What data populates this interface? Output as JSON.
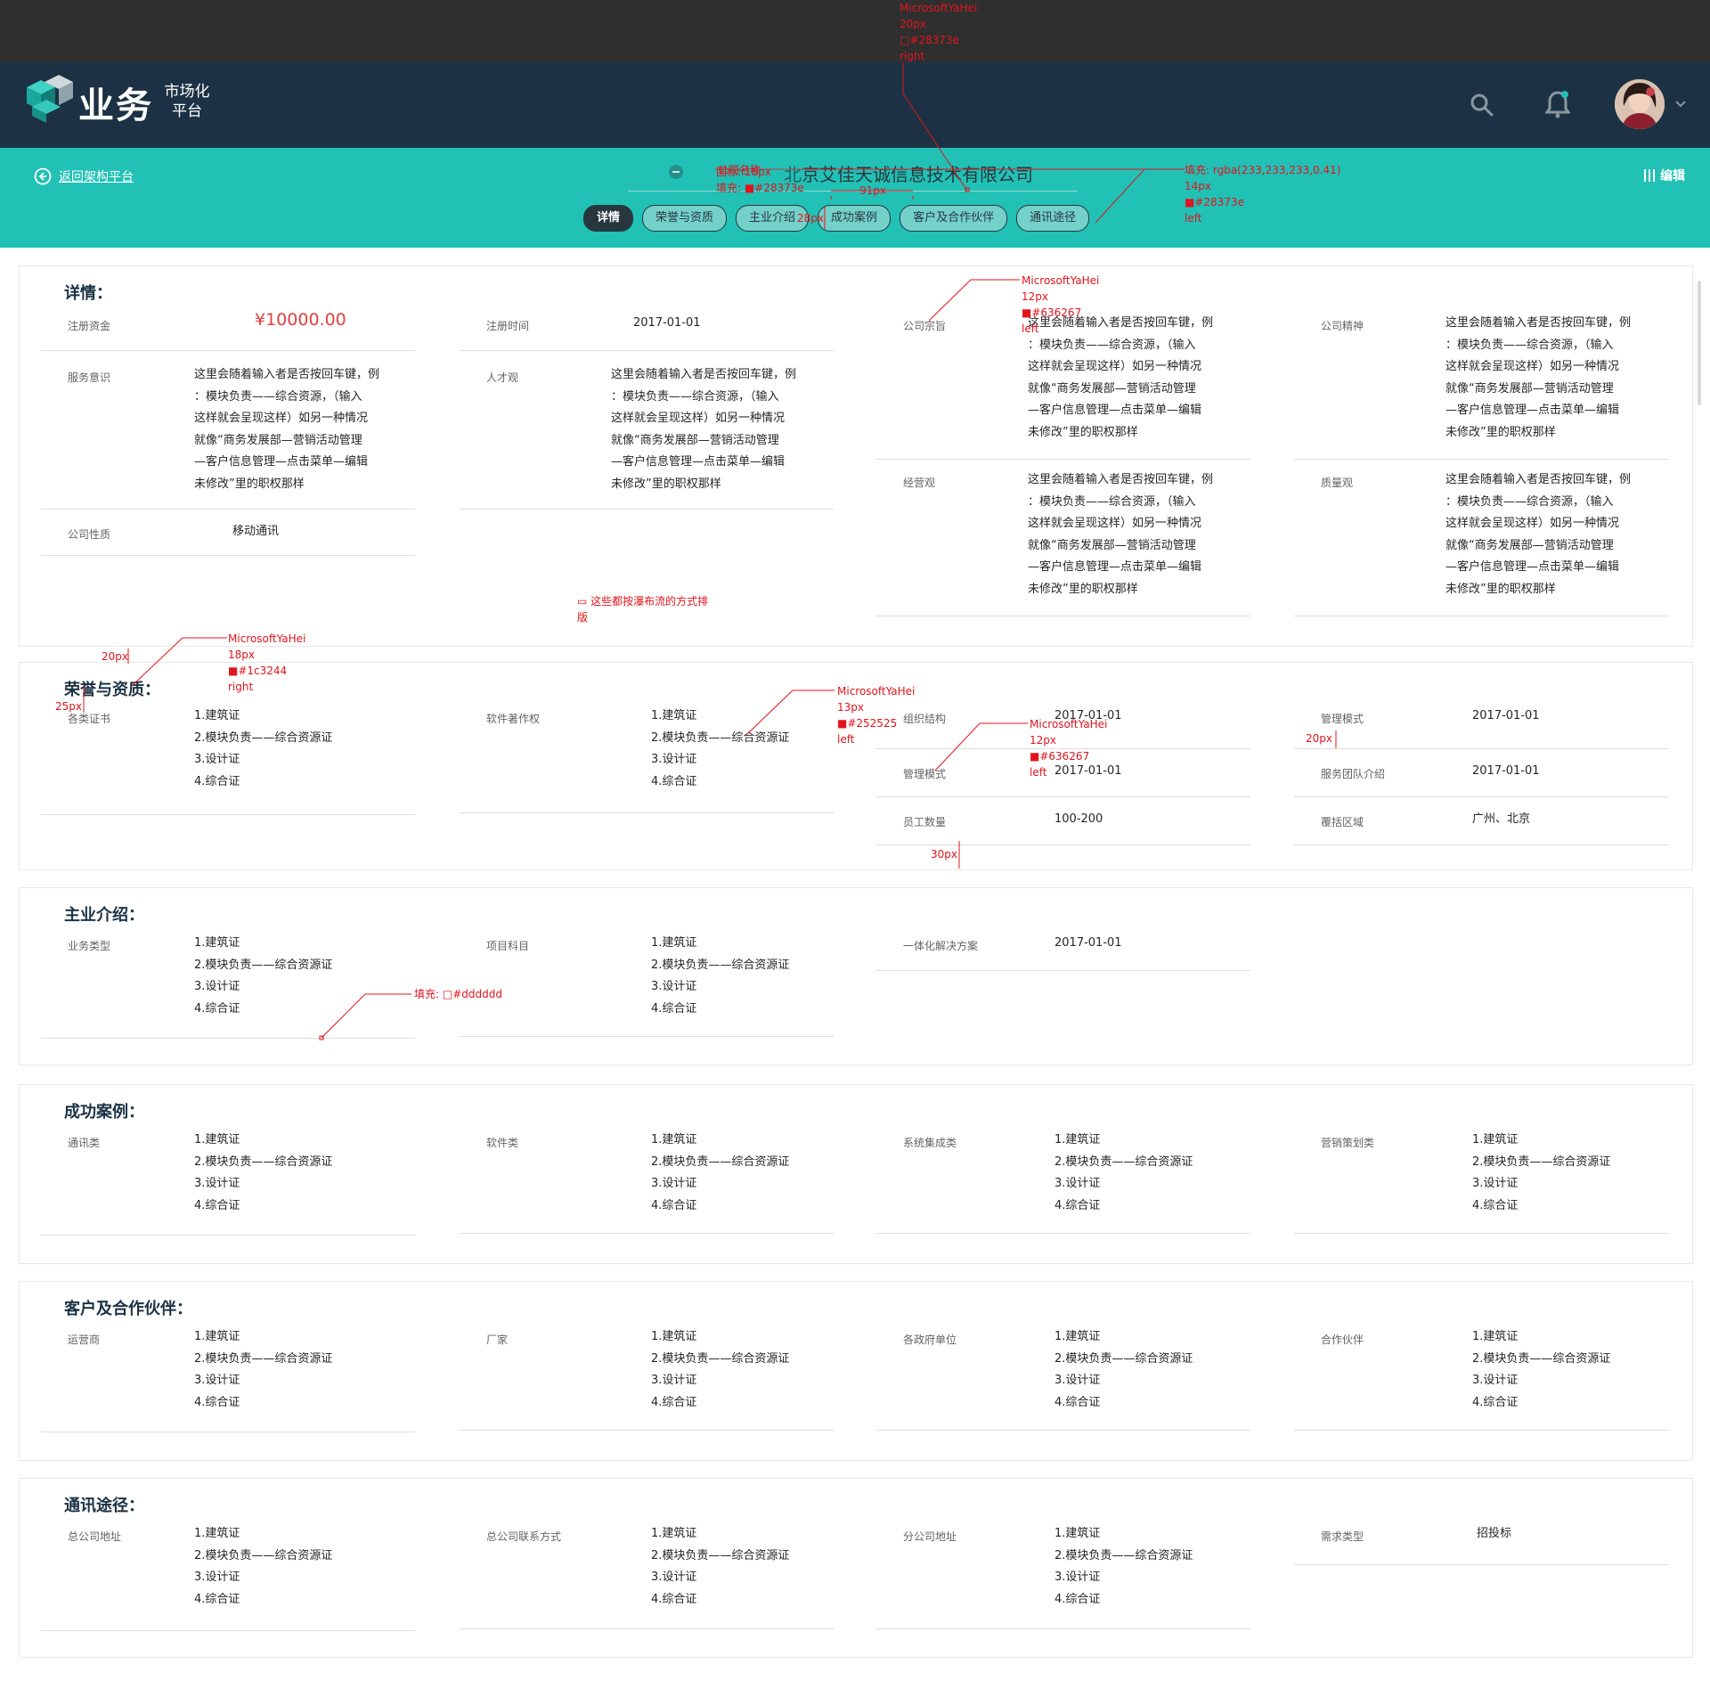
{
  "header": {
    "logo_main": "业务",
    "logo_sub": "市场化 平台",
    "avatar_alt": "avatar"
  },
  "subbar": {
    "back_label": "返回架构平台",
    "company_name": "北京艾佳天诚信息技术有限公司",
    "edit_label": "编辑",
    "tabs": [
      "详情",
      "荣誉与资质",
      "主业介绍",
      "成功案例",
      "客户及合作伙伴",
      "通讯途径"
    ]
  },
  "sections": {
    "detail": {
      "title": "详情：",
      "reg_capital_label": "注册资金",
      "reg_capital_value": "¥10000.00",
      "reg_time_label": "注册时间",
      "reg_time_value": "2017-01-01",
      "purpose_label": "公司宗旨",
      "purpose_value": "这里会随着输入者是否按回车键，例\n：模块负责——综合资源，（输入\n这样就会呈现这样）如另一种情况\n就像“商务发展部—营销活动管理\n—客户信息管理—点击菜单—编辑\n未修改”里的职权那样",
      "spirit_label": "公司精神",
      "spirit_value": "这里会随着输入者是否按回车键，例\n：模块负责——综合资源，（输入\n这样就会呈现这样）如另一种情况\n就像“商务发展部—营销活动管理\n—客户信息管理—点击菜单—编辑\n未修改”里的职权那样",
      "service_label": "服务意识",
      "service_value": "这里会随着输入者是否按回车键，例\n：模块负责——综合资源，（输入\n这样就会呈现这样）如另一种情况\n就像“商务发展部—营销活动管理\n—客户信息管理—点击菜单—编辑\n未修改”里的职权那样",
      "talent_label": "人才观",
      "talent_value": "这里会随着输入者是否按回车键，例\n：模块负责——综合资源，（输入\n这样就会呈现这样）如另一种情况\n就像“商务发展部—营销活动管理\n—客户信息管理—点击菜单—编辑\n未修改”里的职权那样",
      "business_label": "经营观",
      "business_value": "这里会随着输入者是否按回车键，例\n：模块负责——综合资源，（输入\n这样就会呈现这样）如另一种情况\n就像“商务发展部—营销活动管理\n—客户信息管理—点击菜单—编辑\n未修改”里的职权那样",
      "quality_label": "质量观",
      "quality_value": "这里会随着输入者是否按回车键，例\n：模块负责——综合资源，（输入\n这样就会呈现这样）如另一种情况\n就像“商务发展部—营销活动管理\n—客户信息管理—点击菜单—编辑\n未修改”里的职权那样",
      "nature_label": "公司性质",
      "nature_value": "移动通讯"
    },
    "honor": {
      "title": "荣誉与资质：",
      "cert_label": "各类证书",
      "cert_value": "1.建筑证\n2.模块负责——综合资源证\n3.设计证\n4.综合证",
      "software_label": "软件著作权",
      "software_value": "1.建筑证\n2.模块负责——综合资源证\n3.设计证\n4.综合证",
      "org_label": "组织结构",
      "org_value": "2017-01-01",
      "mgmt_mode_label": "管理模式",
      "mgmt_mode_value": "2017-01-01",
      "mgmt_mode2_label": "管理模式",
      "mgmt_mode2_value": "2017-01-01",
      "service_team_label": "服务团队介绍",
      "service_team_value": "2017-01-01",
      "staff_label": "员工数量",
      "staff_value": "100-200",
      "region_label": "覆括区域",
      "region_value": "广州、北京"
    },
    "main_business": {
      "title": "主业介绍：",
      "type_label": "业务类型",
      "type_value": "1.建筑证\n2.模块负责——综合资源证\n3.设计证\n4.综合证",
      "project_label": "项目科目",
      "project_value": "1.建筑证\n2.模块负责——综合资源证\n3.设计证\n4.综合证",
      "solution_label": "一体化解决方案",
      "solution_value": "2017-01-01"
    },
    "cases": {
      "title": "成功案例：",
      "items": [
        {
          "label": "通讯类",
          "value": "1.建筑证\n2.模块负责——综合资源证\n3.设计证\n4.综合证"
        },
        {
          "label": "软件类",
          "value": "1.建筑证\n2.模块负责——综合资源证\n3.设计证\n4.综合证"
        },
        {
          "label": "系统集成类",
          "value": "1.建筑证\n2.模块负责——综合资源证\n3.设计证\n4.综合证"
        },
        {
          "label": "营销策划类",
          "value": "1.建筑证\n2.模块负责——综合资源证\n3.设计证\n4.综合证"
        }
      ]
    },
    "partners": {
      "title": "客户及合作伙伴：",
      "items": [
        {
          "label": "运营商",
          "value": "1.建筑证\n2.模块负责——综合资源证\n3.设计证\n4.综合证"
        },
        {
          "label": "厂家",
          "value": "1.建筑证\n2.模块负责——综合资源证\n3.设计证\n4.综合证"
        },
        {
          "label": "各政府单位",
          "value": "1.建筑证\n2.模块负责——综合资源证\n3.设计证\n4.综合证"
        },
        {
          "label": "合作伙伴",
          "value": "1.建筑证\n2.模块负责——综合资源证\n3.设计证\n4.综合证"
        }
      ]
    },
    "contact": {
      "title": "通讯途径：",
      "items": [
        {
          "label": "总公司地址",
          "value": "1.建筑证\n2.模块负责——综合资源证\n3.设计证\n4.综合证"
        },
        {
          "label": "总公司联系方式",
          "value": "1.建筑证\n2.模块负责——综合资源证\n3.设计证\n4.综合证"
        },
        {
          "label": "分公司地址",
          "value": "1.建筑证\n2.模块负责——综合资源证\n3.设计证\n4.综合证"
        },
        {
          "label": "需求类型",
          "value": "招投标"
        }
      ]
    }
  },
  "annotations": {
    "a_top": "MicrosoftYaHei\n20px\n□#28373e\nright",
    "a_icon": "图标: 16px\n填充: ■#28373e",
    "a_company_label": "公司名称",
    "a_tab_fill": "填充: rgba(233,233,233,0.41)\n14px\n■#28373e\nleft",
    "a_91": "91px",
    "a_28": "28px",
    "a_label_font": "MicrosoftYaHei\n12px\n■#636267\nleft",
    "a_waterfall": "▭ 这些都按瀑布流的方式排\n版",
    "a_title_font": "MicrosoftYaHei\n18px\n■#1c3244\nright",
    "a_20px_a": "20px",
    "a_25px": "25px",
    "a_value_font": "MicrosoftYaHei\n13px\n■#252525\nleft",
    "a_label_font2": "MicrosoftYaHei\n12px\n■#636267\nleft",
    "a_20px_b": "20px",
    "a_30px": "30px",
    "a_fill_ddd": "填充: □#dddddd"
  },
  "colors": {
    "header_bg": "#1c3244",
    "subbar_bg": "#21c1b5",
    "tab_border": "#28373e",
    "title": "#1c3244",
    "label": "#636267",
    "value": "#252525",
    "price": "#e23f3f",
    "annotation": "#e0141e",
    "divider": "#dddddd"
  },
  "icons": [
    "search-icon",
    "bell-icon",
    "chevron-down-icon",
    "back-circle-icon",
    "edit-bars-icon"
  ]
}
